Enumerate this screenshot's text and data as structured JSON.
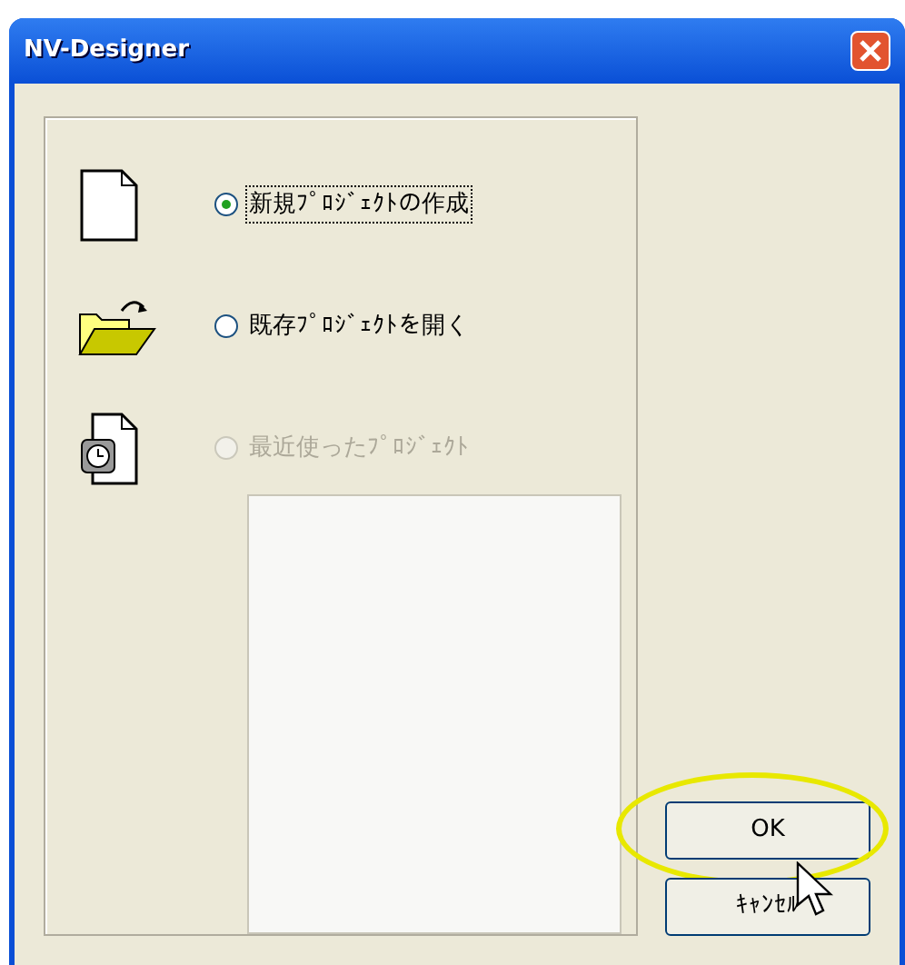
{
  "window": {
    "title": "NV-Designer"
  },
  "options": [
    {
      "kind": "new",
      "label": "新規ﾌﾟﾛｼﾞｪｸﾄの作成",
      "selected": true,
      "disabled": false,
      "focused": true
    },
    {
      "kind": "open",
      "label": "既存ﾌﾟﾛｼﾞｪｸﾄを開く",
      "selected": false,
      "disabled": false,
      "focused": false
    },
    {
      "kind": "recent",
      "label": "最近使ったﾌﾟﾛｼﾞｪｸﾄ",
      "selected": false,
      "disabled": true,
      "focused": false
    }
  ],
  "buttons": [
    {
      "label": "OK",
      "highlighted": true
    },
    {
      "label": "ｷｬﾝｾﾙ",
      "highlighted": false
    }
  ]
}
